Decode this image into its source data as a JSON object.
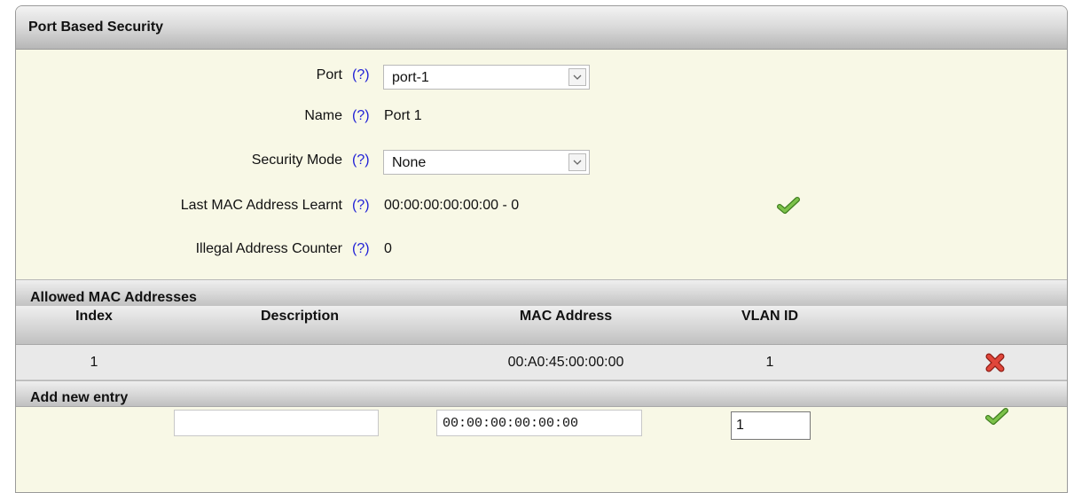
{
  "panel": {
    "title": "Port Based Security"
  },
  "form": {
    "help_text": "(?)",
    "port": {
      "label": "Port",
      "value": "port-1"
    },
    "name": {
      "label": "Name",
      "value": "Port 1"
    },
    "security_mode": {
      "label": "Security Mode",
      "value": "None"
    },
    "last_mac": {
      "label": "Last MAC Address Learnt",
      "value": "00:00:00:00:00:00 - 0"
    },
    "illegal_counter": {
      "label": "Illegal Address Counter",
      "value": "0"
    }
  },
  "allowed": {
    "title": "Allowed MAC Addresses",
    "columns": {
      "index": "Index",
      "description": "Description",
      "mac": "MAC Address",
      "vlan": "VLAN ID"
    },
    "rows": [
      {
        "index": "1",
        "description": "",
        "mac": "00:A0:45:00:00:00",
        "vlan": "1"
      }
    ]
  },
  "add_entry": {
    "title": "Add new entry",
    "description_value": "",
    "mac_value": "00:00:00:00:00:00",
    "vlan_value": "1"
  },
  "icons": {
    "apply": "green-checkmark-icon",
    "delete": "red-x-icon",
    "dropdown": "chevron-down-icon"
  },
  "colors": {
    "background": "#f8f8e6",
    "help_link": "#1f1fd6",
    "check_green": "#5aa02c",
    "delete_red": "#d9372b"
  }
}
